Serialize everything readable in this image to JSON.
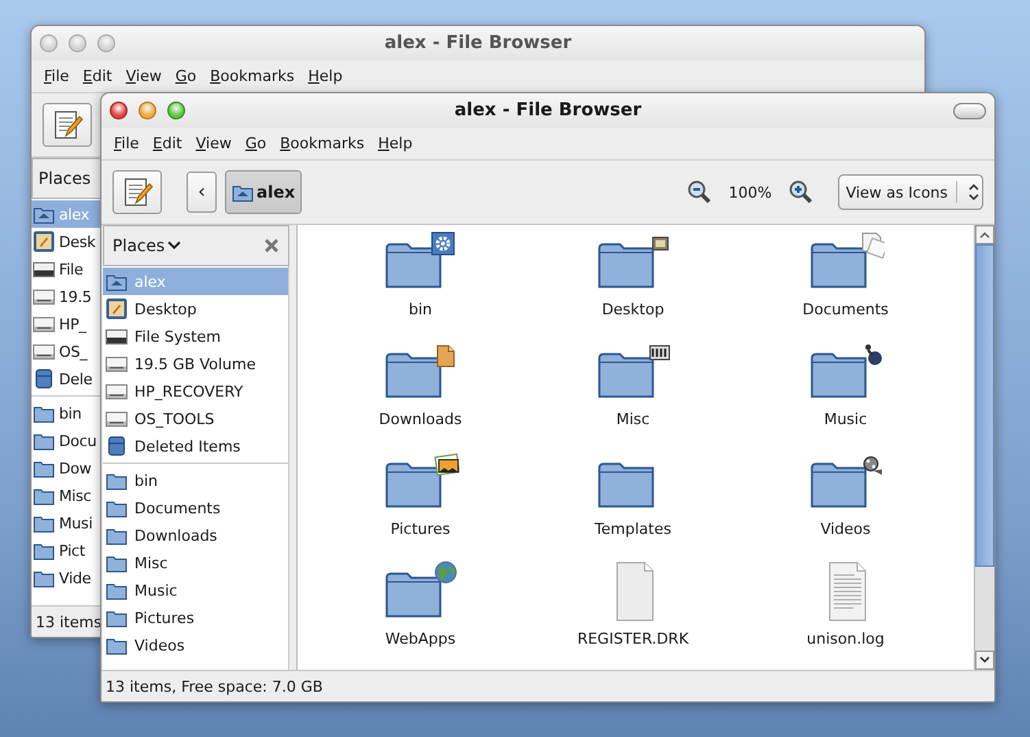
{
  "windows": [
    {
      "title": "alex - File Browser",
      "active": false,
      "menu": [
        "File",
        "Edit",
        "View",
        "Go",
        "Bookmarks",
        "Help"
      ],
      "places_label": "Places",
      "devices": [
        {
          "label": "alex",
          "kind": "home",
          "selected": true
        },
        {
          "label": "Desk",
          "kind": "desktop",
          "selected": false
        },
        {
          "label": "File",
          "kind": "system-drive",
          "selected": false
        },
        {
          "label": "19.5",
          "kind": "drive",
          "selected": false
        },
        {
          "label": "HP_",
          "kind": "drive",
          "selected": false
        },
        {
          "label": "OS_",
          "kind": "drive",
          "selected": false
        },
        {
          "label": "Dele",
          "kind": "trash",
          "selected": false
        }
      ],
      "bookmarks": [
        {
          "label": "bin",
          "kind": "folder",
          "selected": false
        },
        {
          "label": "Docu",
          "kind": "folder",
          "selected": false
        },
        {
          "label": "Dow",
          "kind": "folder",
          "selected": false
        },
        {
          "label": "Misc",
          "kind": "folder",
          "selected": false
        },
        {
          "label": "Musi",
          "kind": "folder",
          "selected": false
        },
        {
          "label": "Pict",
          "kind": "folder",
          "selected": false
        },
        {
          "label": "Vide",
          "kind": "folder",
          "selected": false
        }
      ],
      "status": "13 items"
    },
    {
      "title": "alex - File Browser",
      "active": true,
      "menu": [
        "File",
        "Edit",
        "View",
        "Go",
        "Bookmarks",
        "Help"
      ],
      "toolbar": {
        "back_symbol": "‹",
        "path": "alex",
        "zoom": "100%",
        "view_mode": "View as Icons"
      },
      "places_label": "Places",
      "devices": [
        {
          "label": "alex",
          "kind": "home",
          "selected": true
        },
        {
          "label": "Desktop",
          "kind": "desktop",
          "selected": false
        },
        {
          "label": "File System",
          "kind": "system-drive",
          "selected": false
        },
        {
          "label": "19.5 GB Volume",
          "kind": "drive",
          "selected": false
        },
        {
          "label": "HP_RECOVERY",
          "kind": "drive",
          "selected": false
        },
        {
          "label": "OS_TOOLS",
          "kind": "drive",
          "selected": false
        },
        {
          "label": "Deleted Items",
          "kind": "trash",
          "selected": false
        }
      ],
      "bookmarks": [
        {
          "label": "bin",
          "kind": "folder",
          "selected": false
        },
        {
          "label": "Documents",
          "kind": "folder",
          "selected": false
        },
        {
          "label": "Downloads",
          "kind": "folder",
          "selected": false
        },
        {
          "label": "Misc",
          "kind": "folder",
          "selected": false
        },
        {
          "label": "Music",
          "kind": "folder",
          "selected": false
        },
        {
          "label": "Pictures",
          "kind": "folder",
          "selected": false
        },
        {
          "label": "Videos",
          "kind": "folder",
          "selected": false
        }
      ],
      "items": [
        {
          "name": "bin",
          "kind": "folder"
        },
        {
          "name": "Desktop",
          "kind": "folder"
        },
        {
          "name": "Documents",
          "kind": "folder"
        },
        {
          "name": "Downloads",
          "kind": "folder"
        },
        {
          "name": "Misc",
          "kind": "folder"
        },
        {
          "name": "Music",
          "kind": "folder"
        },
        {
          "name": "Pictures",
          "kind": "folder"
        },
        {
          "name": "Templates",
          "kind": "folder"
        },
        {
          "name": "Videos",
          "kind": "folder"
        },
        {
          "name": "WebApps",
          "kind": "folder"
        },
        {
          "name": "REGISTER.DRK",
          "kind": "blank-file"
        },
        {
          "name": "unison.log",
          "kind": "text-file"
        }
      ],
      "status": "13 items, Free space: 7.0 GB"
    }
  ]
}
